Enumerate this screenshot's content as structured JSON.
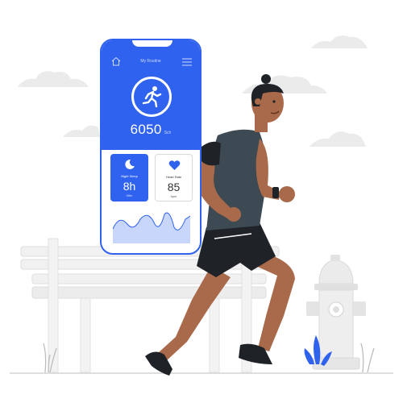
{
  "app": {
    "title": "My Routine",
    "steps": "6050",
    "steps_unit": "Sch"
  },
  "cards": {
    "sleep": {
      "label": "Night Sleep",
      "value": "8h",
      "unit": "05m"
    },
    "heart": {
      "label": "Heart Rate",
      "value": "85",
      "unit": "bpm"
    }
  },
  "icons": {
    "home": "home-icon",
    "menu": "hamburger-menu-icon",
    "runner": "running-person-icon",
    "moon": "moon-icon",
    "heart": "heart-icon"
  },
  "colors": {
    "accent": "#2f62ee",
    "skin": "#a86a4a",
    "shirt": "#3d4a54",
    "shorts": "#1f2227",
    "cloud": "#ebebeb",
    "bench": "#f0f0f0",
    "hydrant": "#e6e6e6"
  }
}
